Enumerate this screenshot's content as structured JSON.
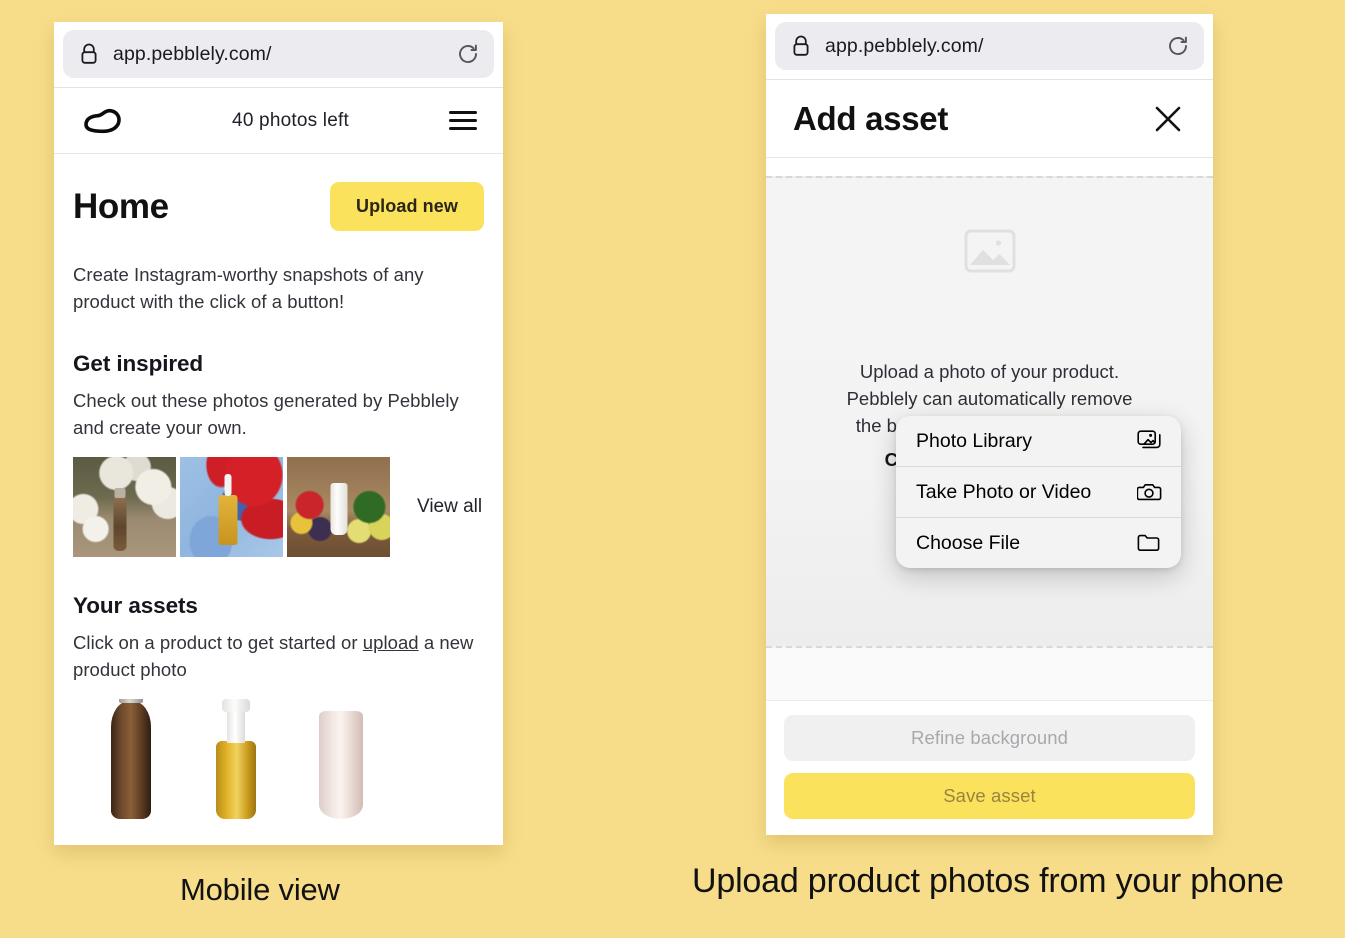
{
  "background_color": "#f7dd8a",
  "accent_yellow": "#fbe25c",
  "captions": {
    "left": "Mobile view",
    "right": "Upload product photos from your phone"
  },
  "left_phone": {
    "browser": {
      "url": "app.pebblely.com/",
      "lock_icon": "lock-icon",
      "reload_icon": "reload-icon"
    },
    "app_header": {
      "logo_icon": "pebble-logo-icon",
      "quota_text": "40 photos left",
      "menu_icon": "hamburger-menu-icon"
    },
    "home": {
      "title": "Home",
      "upload_button": "Upload new",
      "intro": "Create Instagram-worthy snapshots of any product with the click of a button!"
    },
    "get_inspired": {
      "heading": "Get inspired",
      "description": "Check out these photos generated by Pebblely and create your own.",
      "view_all": "View all",
      "thumbnails": [
        "bottle-on-wood-with-white-flowers",
        "dropper-bottle-on-red-and-blue-paint",
        "white-tube-with-fruits-on-wood"
      ]
    },
    "your_assets": {
      "heading": "Your assets",
      "description_before": "Click on a product to get started or ",
      "link": "upload",
      "description_after": " a new product photo",
      "items": [
        "wood-grain-water-bottle",
        "amber-dropper-bottle",
        "pink-cosmetic-tube"
      ]
    }
  },
  "right_phone": {
    "browser": {
      "url": "app.pebblely.com/",
      "lock_icon": "lock-icon",
      "reload_icon": "reload-icon"
    },
    "modal": {
      "title": "Add asset",
      "close_icon": "close-icon"
    },
    "dropzone": {
      "placeholder_icon": "image-placeholder-icon",
      "line1": "Upload a photo of your product.",
      "line2": "Pebblely can automatically remove",
      "line3": "the background from your photo!",
      "cta": "Click to select an image"
    },
    "action_sheet": {
      "items": [
        {
          "label": "Photo Library",
          "icon": "photo-library-icon"
        },
        {
          "label": "Take Photo or Video",
          "icon": "camera-icon"
        },
        {
          "label": "Choose File",
          "icon": "folder-icon"
        }
      ]
    },
    "footer": {
      "refine_button": "Refine background",
      "save_button": "Save asset"
    }
  }
}
